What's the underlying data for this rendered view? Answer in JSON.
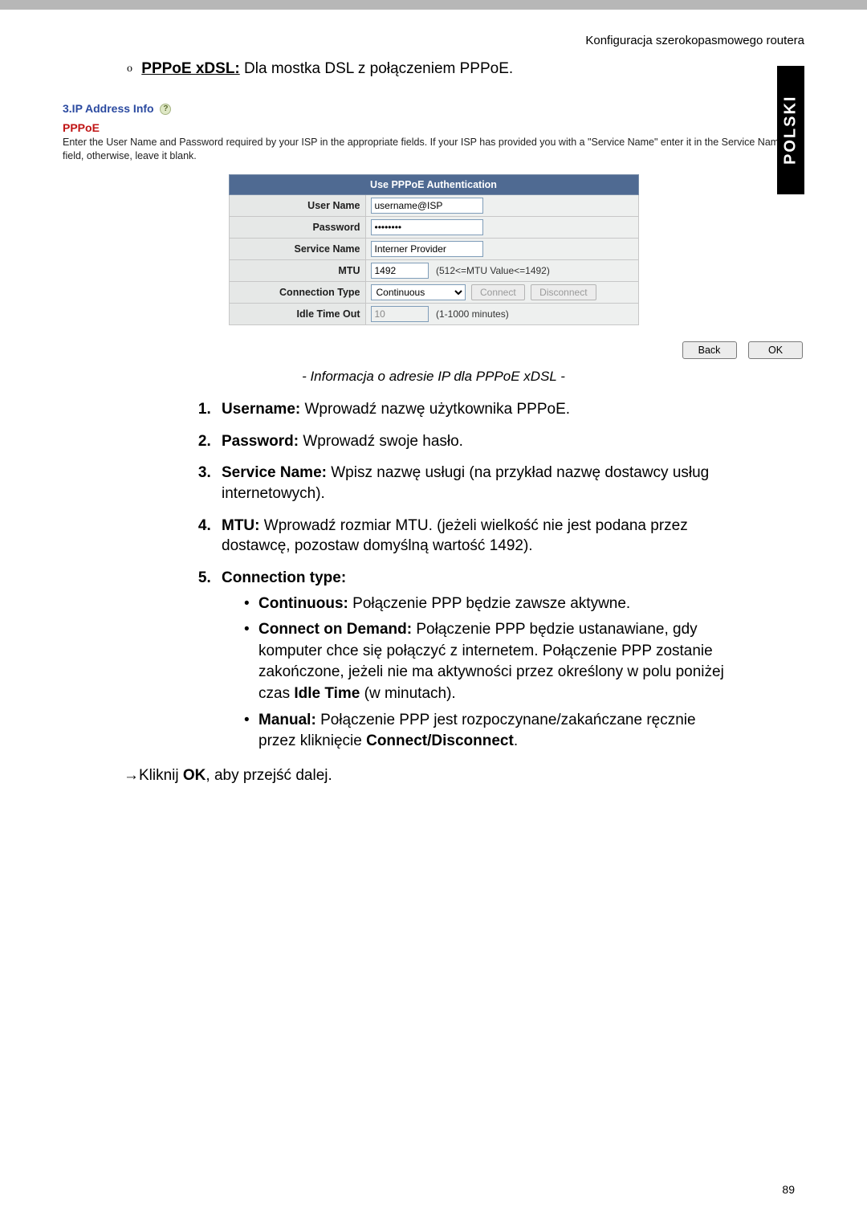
{
  "header": {
    "title": "Konfiguracja szerokopasmowego routera"
  },
  "sidetab": "POLSKI",
  "intro": {
    "label": "PPPoE xDSL:",
    "text": "Dla mostka DSL z połączeniem PPPoE."
  },
  "shot": {
    "step_heading": "3.IP Address Info",
    "title": "PPPoE",
    "desc": "Enter the User Name and Password required by your ISP in the appropriate fields. If your ISP has provided you with a \"Service Name\" enter it in the Service Name field, otherwise, leave it blank.",
    "table_header": "Use PPPoE Authentication",
    "rows": {
      "user_name": {
        "label": "User Name",
        "value": "username@ISP"
      },
      "password": {
        "label": "Password",
        "value": "••••••••"
      },
      "service_name": {
        "label": "Service Name",
        "value": "Interner Provider"
      },
      "mtu": {
        "label": "MTU",
        "value": "1492",
        "hint": "(512<=MTU Value<=1492)"
      },
      "conn_type": {
        "label": "Connection Type",
        "selected": "Continuous",
        "btn_connect": "Connect",
        "btn_disconnect": "Disconnect"
      },
      "idle": {
        "label": "Idle Time Out",
        "value": "10",
        "hint": "(1-1000 minutes)"
      }
    },
    "buttons": {
      "back": "Back",
      "ok": "OK"
    }
  },
  "caption": "- Informacja o adresie IP dla PPPoE xDSL -",
  "list": {
    "i1": {
      "b": "Username:",
      "t": "Wprowadź nazwę użytkownika PPPoE."
    },
    "i2": {
      "b": "Password:",
      "t": "Wprowadź swoje hasło."
    },
    "i3": {
      "b": "Service Name:",
      "t": "Wpisz nazwę usługi (na przykład nazwę dostawcy usług internetowych)."
    },
    "i4": {
      "b": "MTU:",
      "t": "Wprowadź rozmiar MTU. (jeżeli wielkość nie jest podana przez dostawcę, pozostaw domyślną wartość 1492)."
    },
    "i5": {
      "b": "Connection type:",
      "sub": {
        "s1": {
          "b": "Continuous:",
          "t": "Połączenie PPP będzie zawsze aktywne."
        },
        "s2": {
          "b": "Connect on Demand:",
          "t1": "Połączenie PPP będzie ustanawiane, gdy komputer chce się połączyć z internetem. Połączenie PPP zostanie zakończone, jeżeli nie ma aktywności przez określony w polu poniżej czas ",
          "b2": "Idle Time",
          "t2": " (w minutach)."
        },
        "s3": {
          "b": "Manual:",
          "t1": "Połączenie PPP jest rozpoczynane/zakańczane ręcznie przez kliknięcie ",
          "b2": "Connect/Disconnect",
          "t2": "."
        }
      }
    }
  },
  "final": {
    "pre": "Kliknij ",
    "b": "OK",
    "post": ", aby przejść dalej."
  },
  "page_number": "89",
  "chart_data": {
    "type": "table",
    "title": "Use PPPoE Authentication",
    "rows": [
      {
        "field": "User Name",
        "value": "username@ISP"
      },
      {
        "field": "Password",
        "value": "••••••••"
      },
      {
        "field": "Service Name",
        "value": "Interner Provider"
      },
      {
        "field": "MTU",
        "value": "1492",
        "note": "(512<=MTU Value<=1492)"
      },
      {
        "field": "Connection Type",
        "value": "Continuous",
        "buttons": [
          "Connect",
          "Disconnect"
        ]
      },
      {
        "field": "Idle Time Out",
        "value": "10",
        "note": "(1-1000 minutes)"
      }
    ]
  }
}
